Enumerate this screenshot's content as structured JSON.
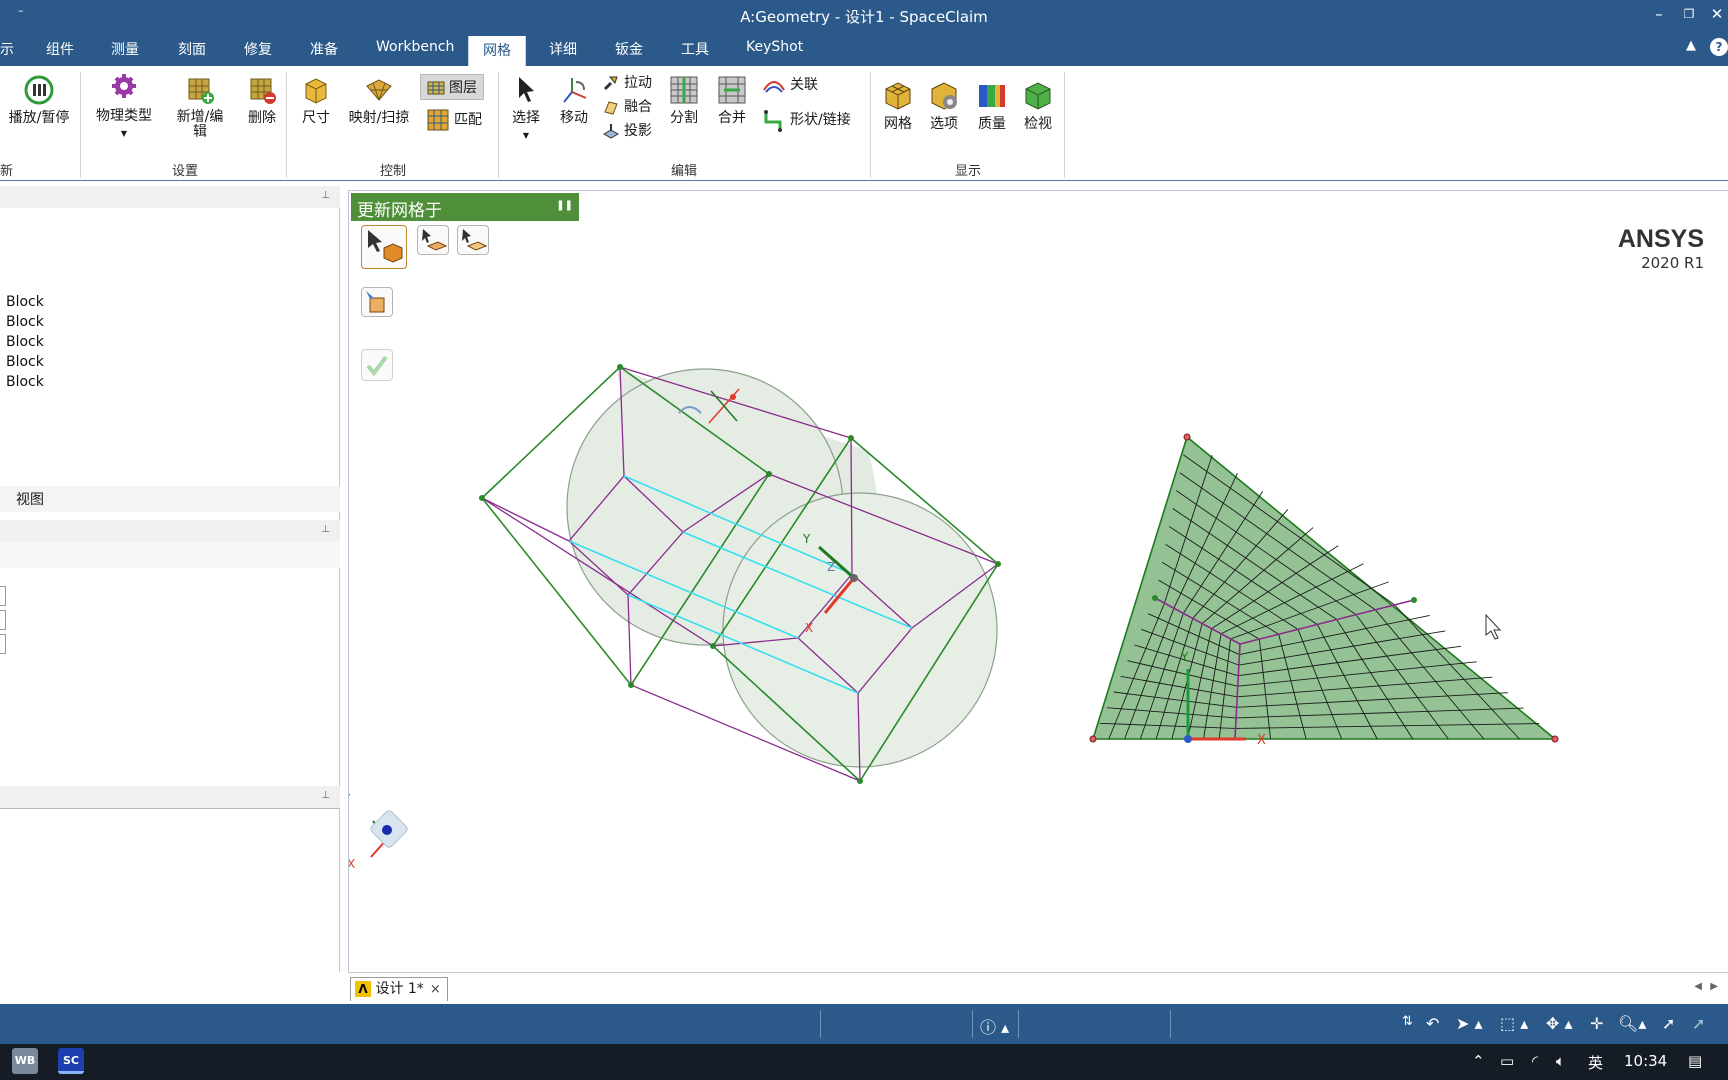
{
  "window": {
    "title": "A:Geometry - 设计1 - SpaceClaim",
    "qa_glyph": "–"
  },
  "tabs": {
    "partial_left": "示",
    "items": [
      "组件",
      "测量",
      "刻面",
      "修复",
      "准备",
      "Workbench",
      "网格",
      "详细",
      "钣金",
      "工具",
      "KeyShot"
    ],
    "active": "网格"
  },
  "ribbon": {
    "play_pause": "播放/暂停",
    "physics_type": "物理类型",
    "new_edit": "新增/编\n辑",
    "delete": "删除",
    "size": "尺寸",
    "map_sweep": "映射/扫掠",
    "layers": "图层",
    "match": "匹配",
    "select": "选择",
    "move": "移动",
    "pull": "拉动",
    "blend": "融合",
    "project": "投影",
    "split": "分割",
    "merge": "合并",
    "associate": "关联",
    "shape_link": "形状/链接",
    "mesh": "网格",
    "options": "选项",
    "quality": "质量",
    "inspect": "检视",
    "groups": {
      "partial_left": "新",
      "setup": "设置",
      "control": "控制",
      "edit": "编辑",
      "display": "显示"
    }
  },
  "left_panel": {
    "tree_items": [
      "Block",
      "Block",
      "Block",
      "Block",
      "Block"
    ],
    "view_label": "视图"
  },
  "viewport": {
    "mesh_bar_label": "更新网格于",
    "brand": "ANSYS",
    "version": "2020 R1",
    "axis_x": "X",
    "axis_y": "Y",
    "axis_z": "Z"
  },
  "doc_tab": {
    "label": "设计 1*",
    "close": "×"
  },
  "taskbar": {
    "app1": "WB",
    "app2": "SC",
    "ime": "英",
    "time": "10:34"
  },
  "colors": {
    "titlebar": "#2b5a8a",
    "mesh_green": "#4f8f3a",
    "edge_purple": "#8a2c8e",
    "edge_cyan": "#2ee0f0"
  }
}
